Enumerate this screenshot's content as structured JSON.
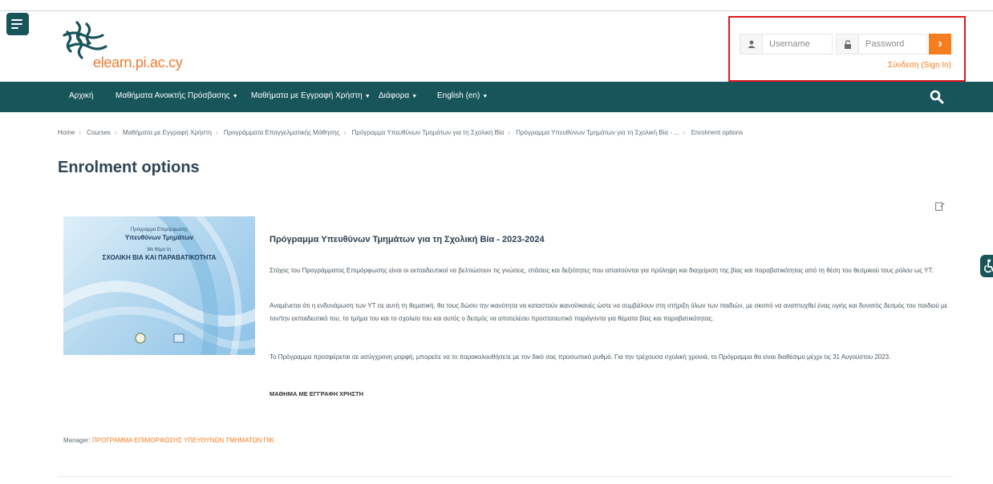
{
  "header": {
    "logo_text": "elearn.pi.ac.cy",
    "username_placeholder": "Username",
    "password_placeholder": "Password",
    "signin_label": "Σύνδεση (Sign In)"
  },
  "nav": {
    "items": [
      {
        "label": "Αρχική",
        "caret": false
      },
      {
        "label": "Μαθήματα Ανοικτής Πρόσβασης",
        "caret": true
      },
      {
        "label": "Μαθήματα με Εγγραφή Χρήστη",
        "caret": true
      },
      {
        "label": "Διάφορα",
        "caret": true
      },
      {
        "label": "English (en)",
        "caret": true
      }
    ]
  },
  "breadcrumb": [
    "Home",
    "Courses",
    "Μαθήματα με Εγγραφή Χρήστη",
    "Προγράμματα Επαγγελματικής Μάθησης",
    "Πρόγραμμα Υπευθύνων Τμημάτων για τη Σχολική Βία",
    "Πρόγραμμα Υπευθύνων Τμημάτων για τη Σχολική Βία - ...",
    "Enrolment options"
  ],
  "page": {
    "title": "Enrolment options"
  },
  "course": {
    "image_text": {
      "line1": "Πρόγραμμα Επιμόρφωσης",
      "line2": "Υπευθύνων Τμημάτων",
      "line3": "Με θέμα τη",
      "line4": "ΣΧΟΛΙΚΗ ΒΙΑ ΚΑΙ ΠΑΡΑΒΑΤΙΚΟΤΗΤΑ"
    },
    "title": "Πρόγραμμα Υπευθύνων Τμημάτων για τη Σχολική Βία - 2023-2024",
    "para1": "Στόχος του Προγράμματος Επιμόρφωσης είναι οι εκπαιδευτικοί να βελτιώσουν τις γνώσεις, στάσεις και δεξιότητες που απαιτούνται για πρόληψη και διαχείριση της βίας και παραβατικότητας από τη θέση του θεσμικού τους ρόλου ως ΥΤ.",
    "para2": "Αναμένεται ότι η ενδυνάμωση των ΥΤ σε αυτή τη θεματική, θα τους δώσει την ικανότητα να καταστούν ικανοί/ικανές ώστε να συμβάλουν στη στήριξη όλων των παιδιών, με σκοπό να αναπτυχθεί ένας υγιής και δυνατός δεσμός του παιδιού με τον/την εκπαιδευτικό του, το τμήμα του και το σχολείο του και αυτός ο δεσμός να αποτελέσει προστατευτικό παράγοντα για θέματα βίας και παραβατικότητας.",
    "para3": "Το Πρόγραμμα προσφέρεται σε ασύγχρονη μορφή, μπορείτε να το παρακολουθήσετε με τον δικό σας προσωπικό ρυθμό. Για την τρέχουσα σχολική χρονιά, το Πρόγραμμα θα είναι διαθέσιμο μέχρι τις 31 Αυγούστου 2023.",
    "tag": "ΜΑΘΗΜΑ ΜΕ ΕΓΓΡΑΦΗ ΧΡΗΣΤΗ"
  },
  "manager": {
    "label": "Manager:",
    "name": "ΠΡΟΓΡΑΜΜΑ ΕΠΙΜΟΡΦΩΣΗΣ ΥΠΕΥΘΥΝΩΝ ΤΜΗΜΑΤΩΝ ΠΙΚ"
  },
  "colors": {
    "brand_teal": "#17555b",
    "accent_orange": "#f47d20",
    "highlight_red": "#e0161f"
  },
  "icons": [
    "menu-icon",
    "user-icon",
    "lock-icon",
    "chevron-right-icon",
    "search-icon",
    "edit-icon",
    "accessibility-icon"
  ]
}
